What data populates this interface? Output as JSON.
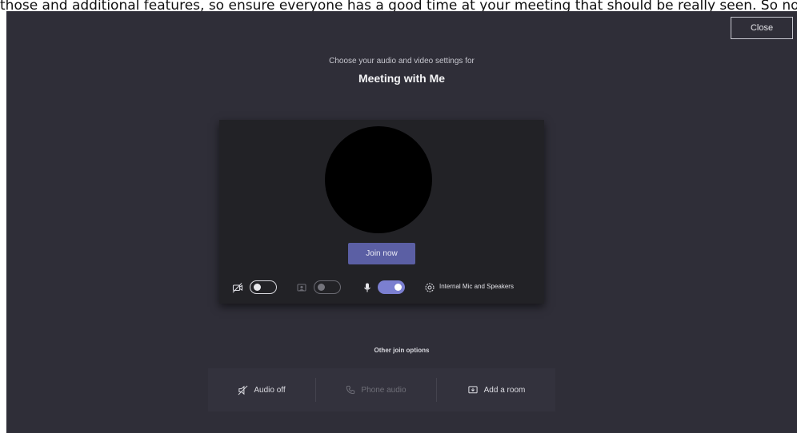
{
  "banner": {
    "text": "those and additional features, so ensure everyone has a good time at your meeting that should be really seen. So now no one gets to your options, including video."
  },
  "window": {
    "close_label": "Close"
  },
  "header": {
    "subtitle": "Choose your audio and video settings for",
    "title": "Meeting with Me"
  },
  "preview": {
    "join_label": "Join now",
    "controls": {
      "video_icon": "camera-off-icon",
      "video_toggle": {
        "state": "off"
      },
      "blur_icon": "background-blur-icon",
      "blur_toggle": {
        "state": "off",
        "disabled": true
      },
      "mic_icon": "microphone-icon",
      "mic_toggle": {
        "state": "on"
      },
      "device_icon": "gear-icon",
      "device_label": "Internal Mic and Speakers"
    }
  },
  "other_options": {
    "title": "Other join options",
    "items": [
      {
        "label": "Audio off",
        "icon": "speaker-off-icon",
        "disabled": false
      },
      {
        "label": "Phone audio",
        "icon": "phone-icon",
        "disabled": true
      },
      {
        "label": "Add a room",
        "icon": "cast-room-icon",
        "disabled": false
      }
    ]
  },
  "colors": {
    "background": "#2f2e38",
    "preview_bg": "#222226",
    "accent": "#5b5fa4",
    "toggle_on": "#7b7fd0",
    "text_primary": "#f4f4f6",
    "text_muted": "#6f6f78"
  }
}
